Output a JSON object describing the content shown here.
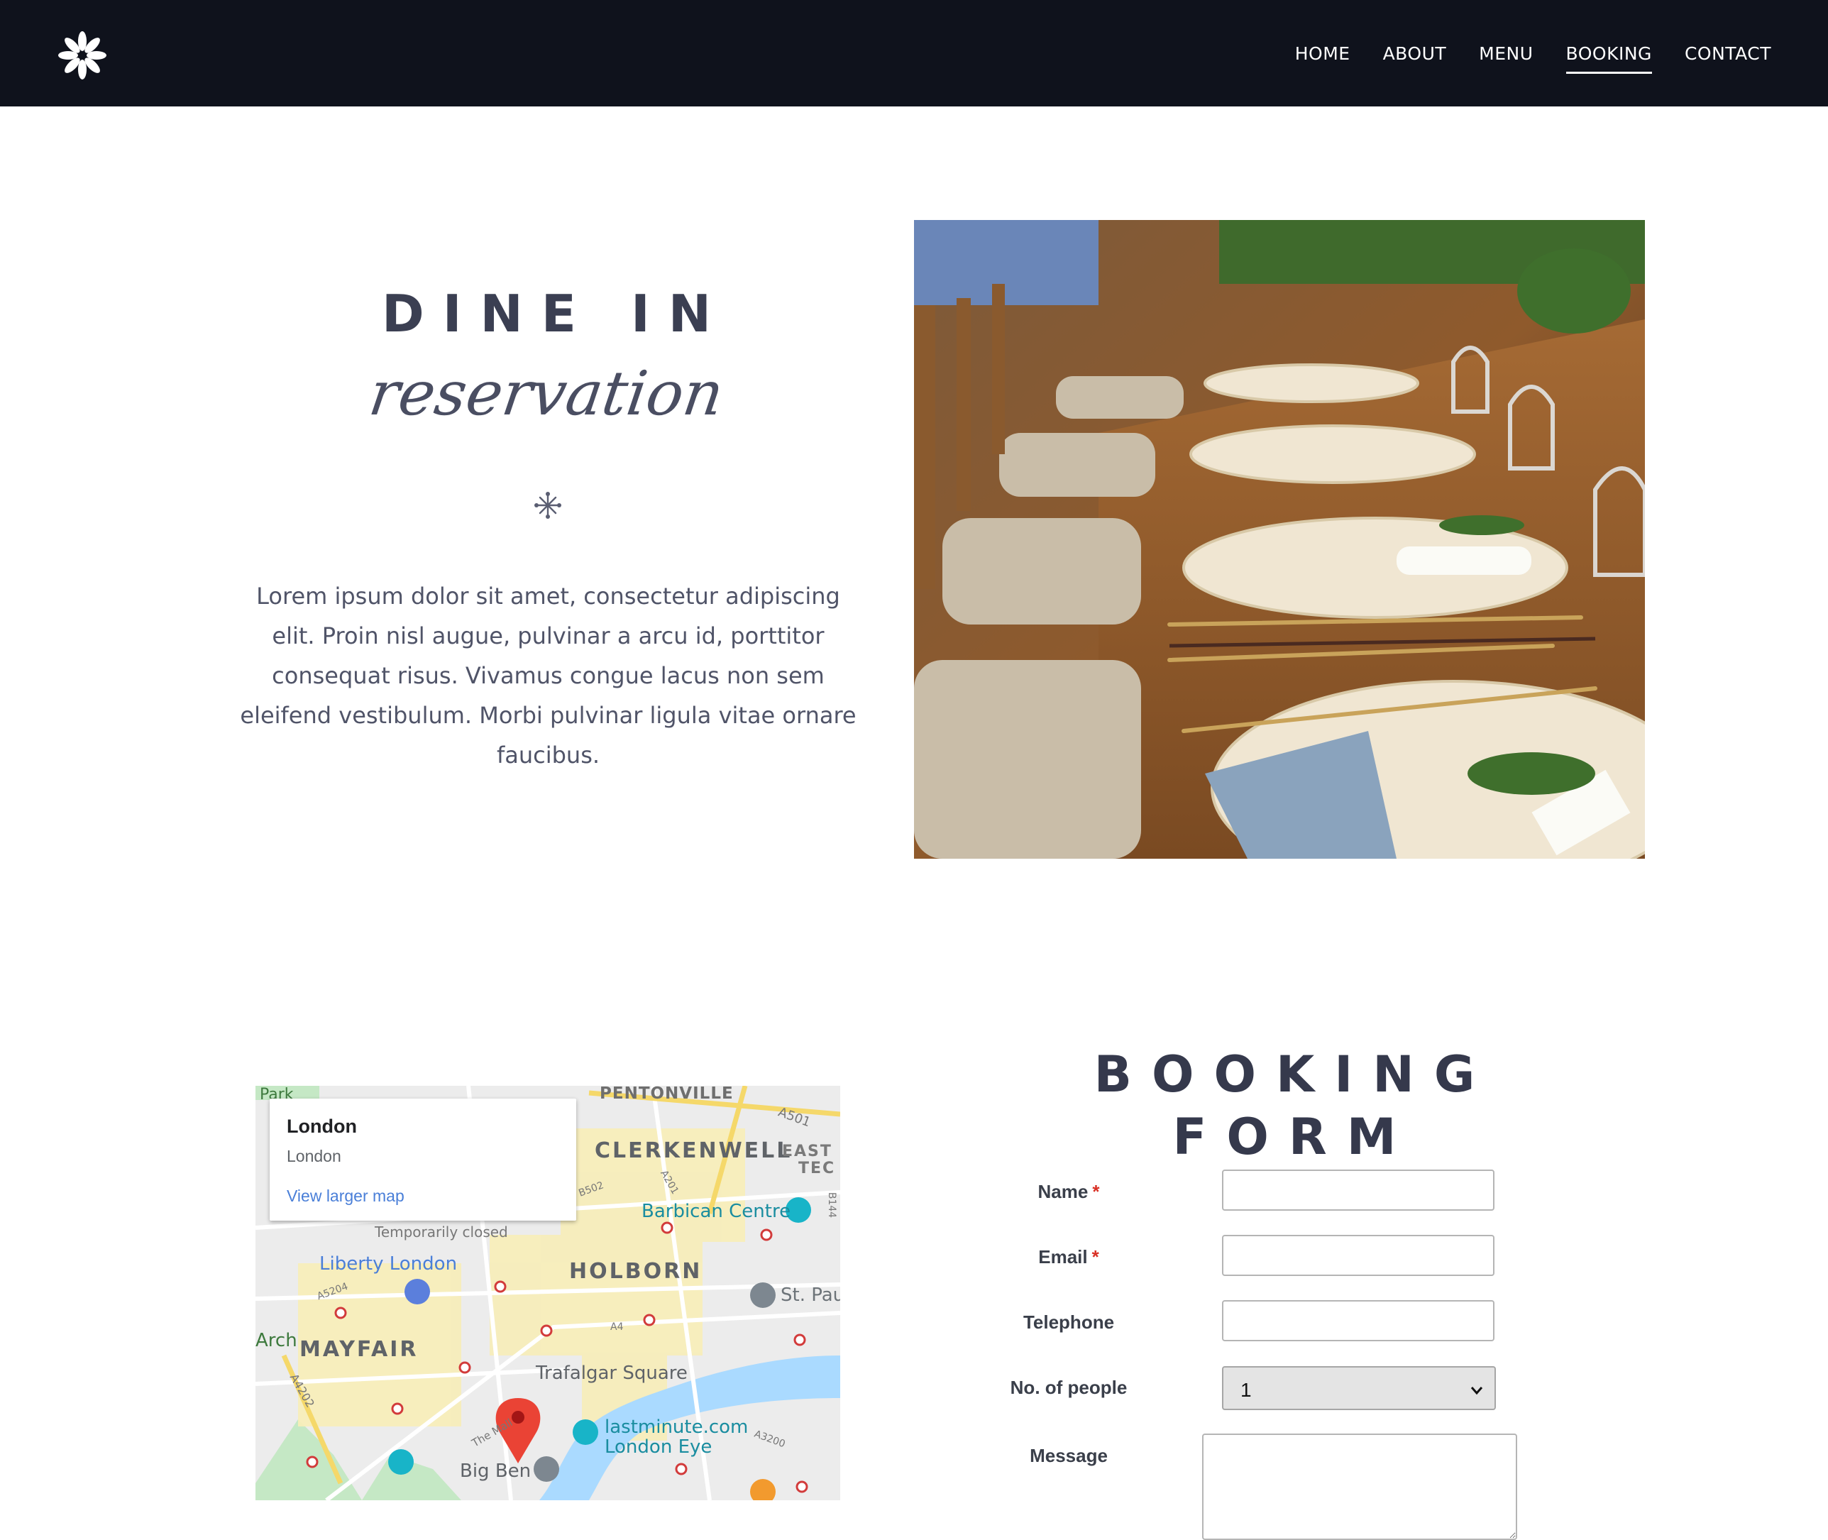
{
  "nav": {
    "logo_icon": "asterisk-flower-icon",
    "items": [
      {
        "label": "HOME"
      },
      {
        "label": "ABOUT"
      },
      {
        "label": "MENU"
      },
      {
        "label": "BOOKING",
        "active": true
      },
      {
        "label": "CONTACT"
      }
    ]
  },
  "hero": {
    "title": "DINE IN",
    "subtitle": "reservation",
    "divider_icon": "asterisk-icon",
    "text": "Lorem ipsum dolor sit amet, consectetur adipiscing elit. Proin nisl augue, pulvinar a arcu id, porttitor consequat risus. Vivamus congue lacus non sem eleifend vestibulum. Morbi pulvinar ligula vitae ornare faucibus."
  },
  "map": {
    "card": {
      "title": "London",
      "subtitle": "London",
      "link": "View larger map"
    },
    "labels": {
      "pentonville": "PENTONVILLE",
      "park": "Park",
      "clerkenwell": "CLERKENWELL",
      "east": "EAST",
      "tec": "TEC",
      "barbican": "Barbican Centre",
      "temporarily_closed": "Temporarily closed",
      "liberty": "Liberty London",
      "holborn": "HOLBORN",
      "st_paul": "St. Pau",
      "arch": "Arch",
      "mayfair": "MAYFAIR",
      "trafalgar": "Trafalgar Square",
      "london_eye_1": "lastminute.com",
      "london_eye_2": "London Eye",
      "big_ben": "Big Ben",
      "the_mall": "The Mall",
      "a501": "A501",
      "a201": "A201",
      "b502": "B502",
      "b144": "B144",
      "a5204": "A5204",
      "a4": "A4",
      "a4202": "A4202",
      "a3200": "A3200"
    },
    "colors": {
      "park": "#c5e8c5",
      "water": "#aadaff",
      "land": "#ececec",
      "pin": "#ea4335"
    }
  },
  "form": {
    "title_line1": "BOOKING",
    "title_line2": "FORM",
    "fields": {
      "name": {
        "label": "Name",
        "required": "*"
      },
      "email": {
        "label": "Email",
        "required": "*"
      },
      "telephone": {
        "label": "Telephone"
      },
      "people": {
        "label": "No. of people",
        "value": "1",
        "options": [
          "1"
        ]
      },
      "message": {
        "label": "Message"
      }
    }
  }
}
